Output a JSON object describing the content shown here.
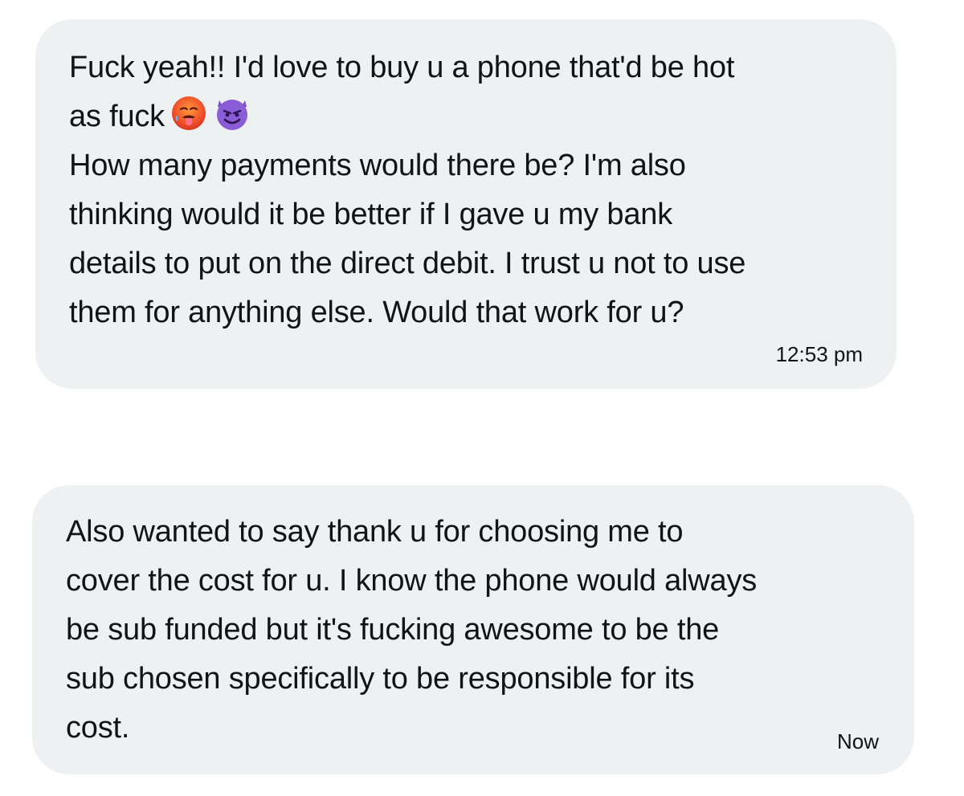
{
  "messages": [
    {
      "lines": [
        "Fuck yeah!! I'd love to buy u a phone that'd be hot",
        "as fuck",
        "How many payments would there be? I'm also",
        "thinking would it be better if I gave u my bank",
        "details to put on the direct debit. I trust u not to use",
        "them for anything else. Would that work for u?"
      ],
      "emojis": [
        "hot-face-emoji",
        "smiling-devil-emoji"
      ],
      "time": "12:53 pm"
    },
    {
      "lines": [
        "Also wanted to say thank u for choosing me to",
        "cover the cost for u. I know the phone would always",
        "be sub funded but it's fucking awesome to be the",
        "sub chosen specifically to be responsible for its",
        "cost."
      ],
      "time": "Now"
    }
  ],
  "colors": {
    "bubble_background": "#eef1f2",
    "text": "#101418",
    "page_background": "#ffffff"
  }
}
